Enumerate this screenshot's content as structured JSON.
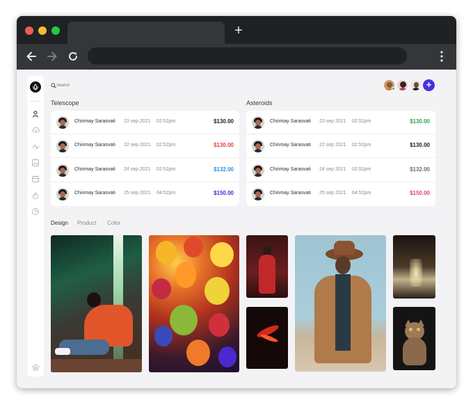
{
  "browser": {
    "new_tab_label": "+",
    "colors": {
      "close": "#ee5c55",
      "minimize": "#f5bd2f",
      "maximize": "#28c73f"
    }
  },
  "search": {
    "placeholder": "Search"
  },
  "header": {
    "add_label": "+"
  },
  "telescope": {
    "title": "Telescope",
    "rows": [
      {
        "name": "Chinmay Sarasvati",
        "date": "23 sep 2021",
        "time": "02:52pm",
        "amount": "$130.00",
        "color": "#1f1f1f"
      },
      {
        "name": "Chinmay Sarasvati",
        "date": "22 sep 2021",
        "time": "02:52pm",
        "amount": "$130.00",
        "color": "#e64040"
      },
      {
        "name": "Chinmay Sarasvati",
        "date": "24 sep 2021",
        "time": "02:52pm",
        "amount": "$132.00",
        "color": "#2f8fe0"
      },
      {
        "name": "Chinmay Sarasvati",
        "date": "25 sep 2021",
        "time": "04:52pm",
        "amount": "$150.00",
        "color": "#3b2fd6"
      }
    ]
  },
  "asteroids": {
    "title": "Asteroids",
    "rows": [
      {
        "name": "Chinmay Sarasvati",
        "date": "23 sep 2021",
        "time": "02:52pm",
        "amount": "$130.00",
        "color": "#2aa84a"
      },
      {
        "name": "Chinmay Sarasvati",
        "date": "22 sep 2021",
        "time": "02:52pm",
        "amount": "$130.00",
        "color": "#1f1f1f"
      },
      {
        "name": "Chinmay Sarasvati",
        "date": "24 sep 2021",
        "time": "02:52pm",
        "amount": "$132.00",
        "color": "#6f6f6f"
      },
      {
        "name": "Chinmay Sarasvati",
        "date": "25 sep 2021",
        "time": "04:52pm",
        "amount": "$150.00",
        "color": "#e0408a"
      }
    ]
  },
  "gallery": {
    "filters": [
      "Design",
      "Product",
      "Color"
    ],
    "active_filter": "Design"
  },
  "sidebar": {
    "icons": [
      "user-icon",
      "cloud-upload-icon",
      "activity-icon",
      "image-icon",
      "calendar-icon",
      "fire-icon",
      "pie-chart-icon"
    ],
    "footer_icon": "settings-icon"
  }
}
